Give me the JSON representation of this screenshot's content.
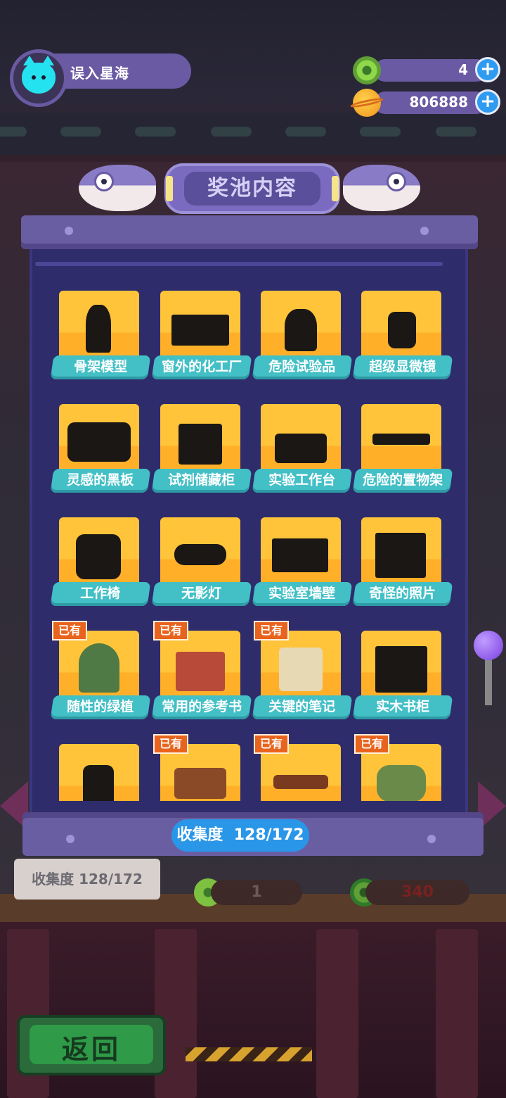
{
  "profile": {
    "name": "误入星海",
    "avatar_icon": "cat-avatar-icon"
  },
  "currencies": [
    {
      "icon": "donut-icon",
      "value": "4"
    },
    {
      "icon": "planet-coin-icon",
      "value": "806888"
    }
  ],
  "modal": {
    "title": "奖池内容",
    "owned_badge": "已有",
    "items": [
      {
        "label": "骨架模型",
        "owned": false,
        "icon": "skeleton-model-icon"
      },
      {
        "label": "窗外的化工厂",
        "owned": false,
        "icon": "chemical-factory-window-icon"
      },
      {
        "label": "危险试验品",
        "owned": false,
        "icon": "specimen-jar-icon"
      },
      {
        "label": "超级显微镜",
        "owned": false,
        "icon": "microscope-icon"
      },
      {
        "label": "灵感的黑板",
        "owned": false,
        "icon": "blackboard-icon"
      },
      {
        "label": "试剂储藏柜",
        "owned": false,
        "icon": "reagent-cabinet-icon"
      },
      {
        "label": "实验工作台",
        "owned": false,
        "icon": "lab-workbench-icon"
      },
      {
        "label": "危险的置物架",
        "owned": false,
        "icon": "shelf-icon"
      },
      {
        "label": "工作椅",
        "owned": false,
        "icon": "office-chair-icon"
      },
      {
        "label": "无影灯",
        "owned": false,
        "icon": "surgical-lamp-icon"
      },
      {
        "label": "实验室墙壁",
        "owned": false,
        "icon": "lab-wall-icon"
      },
      {
        "label": "奇怪的照片",
        "owned": false,
        "icon": "photo-frame-icon"
      },
      {
        "label": "随性的绿植",
        "owned": true,
        "icon": "potted-plant-icon"
      },
      {
        "label": "常用的参考书",
        "owned": true,
        "icon": "book-stack-icon"
      },
      {
        "label": "关键的笔记",
        "owned": true,
        "icon": "quill-notes-icon"
      },
      {
        "label": "实木书柜",
        "owned": false,
        "icon": "bookcase-icon"
      },
      {
        "label": "",
        "owned": false,
        "icon": "glove-icon"
      },
      {
        "label": "",
        "owned": true,
        "icon": "drawer-cabinet-icon"
      },
      {
        "label": "",
        "owned": true,
        "icon": "wooden-bench-icon"
      },
      {
        "label": "",
        "owned": true,
        "icon": "armchair-icon"
      }
    ],
    "collection_label": "收集度",
    "collection_value": "128/172"
  },
  "background_hud": {
    "collection_label": "收集度",
    "collection_value": "128/172",
    "counter_a": "1",
    "counter_b": "340",
    "back_button": "返回"
  }
}
